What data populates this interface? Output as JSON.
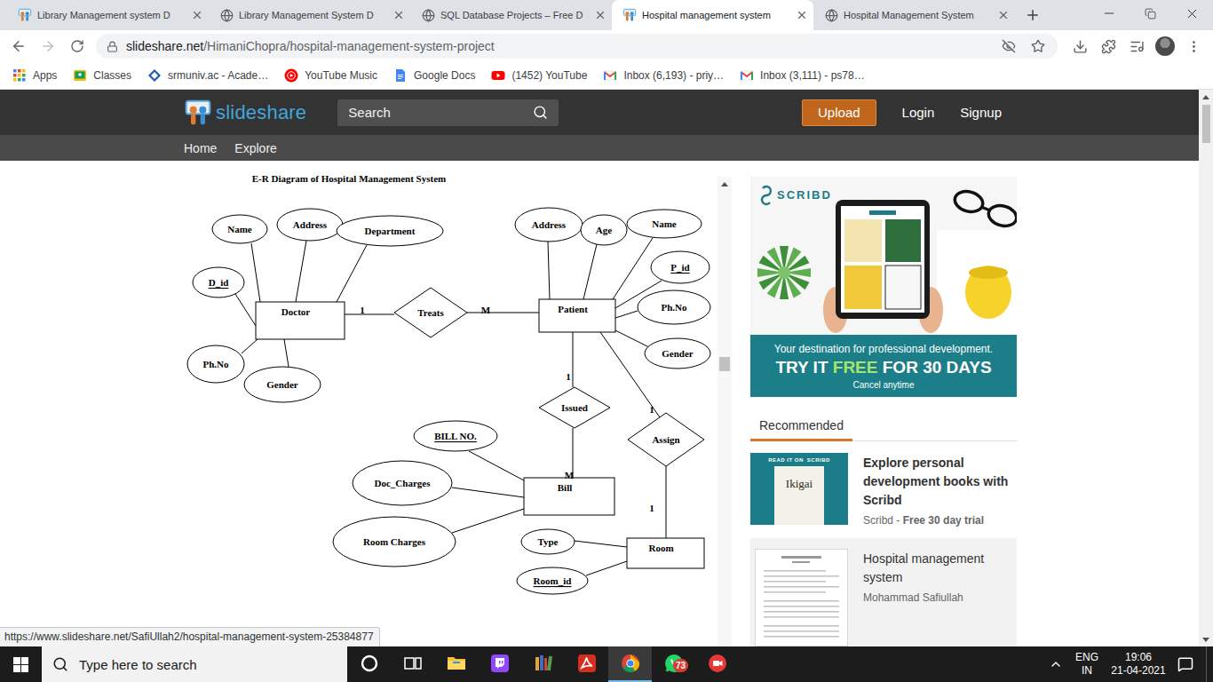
{
  "browser": {
    "tabs": [
      {
        "title": "Library Management system D",
        "selected": false,
        "kind": "slideshare"
      },
      {
        "title": "Library Management System D",
        "selected": false,
        "kind": "globe"
      },
      {
        "title": "SQL Database Projects – Free D",
        "selected": false,
        "kind": "globe"
      },
      {
        "title": "Hospital management system",
        "selected": true,
        "kind": "slideshare"
      },
      {
        "title": "Hospital Management System",
        "selected": false,
        "kind": "globe"
      }
    ],
    "address": {
      "host": "slideshare.net",
      "path": "/HimaniChopra/hospital-management-system-project"
    },
    "bookmarks": [
      {
        "label": "Apps",
        "kind": "apps"
      },
      {
        "label": "Classes",
        "kind": "classes"
      },
      {
        "label": "srmuniv.ac - Acade…",
        "kind": "srm"
      },
      {
        "label": "YouTube Music",
        "kind": "ytmusic"
      },
      {
        "label": "Google Docs",
        "kind": "docs"
      },
      {
        "label": "(1452) YouTube",
        "kind": "youtube"
      },
      {
        "label": "Inbox (6,193) - priy…",
        "kind": "gmail"
      },
      {
        "label": "Inbox (3,111) - ps78…",
        "kind": "gmail"
      }
    ]
  },
  "site": {
    "logo": "slideshare",
    "search": "Search",
    "upload": "Upload",
    "login": "Login",
    "signup": "Signup",
    "nav": [
      "Home",
      "Explore"
    ]
  },
  "diagram": {
    "title": "E-R Diagram of Hospital Management System",
    "nodes": [
      {
        "label": "Doctor",
        "kind": "entity",
        "key": false
      },
      {
        "label": "Patient",
        "kind": "entity",
        "key": false
      },
      {
        "label": "Bill",
        "kind": "entity",
        "key": false
      },
      {
        "label": "Room",
        "kind": "entity",
        "key": false
      },
      {
        "label": "Treats",
        "kind": "relationship",
        "key": false
      },
      {
        "label": "Issued",
        "kind": "relationship",
        "key": false
      },
      {
        "label": "Assign",
        "kind": "relationship",
        "key": false
      },
      {
        "label": "Name",
        "kind": "attribute",
        "key": false
      },
      {
        "label": "Address",
        "kind": "attribute",
        "key": false
      },
      {
        "label": "Department",
        "kind": "attribute",
        "key": false
      },
      {
        "label": "D_id",
        "kind": "attribute",
        "key": true
      },
      {
        "label": "Ph.No",
        "kind": "attribute",
        "key": false
      },
      {
        "label": "Gender",
        "kind": "attribute",
        "key": false
      },
      {
        "label": "Address",
        "kind": "attribute",
        "key": false
      },
      {
        "label": "Age",
        "kind": "attribute",
        "key": false
      },
      {
        "label": "Name",
        "kind": "attribute",
        "key": false
      },
      {
        "label": "P_id",
        "kind": "attribute",
        "key": true
      },
      {
        "label": "Ph.No",
        "kind": "attribute",
        "key": false
      },
      {
        "label": "Gender",
        "kind": "attribute",
        "key": false
      },
      {
        "label": "BILL NO.",
        "kind": "attribute",
        "key": true
      },
      {
        "label": "Doc_Charges",
        "kind": "attribute",
        "key": false
      },
      {
        "label": "Room Charges",
        "kind": "attribute",
        "key": false
      },
      {
        "label": "Type",
        "kind": "attribute",
        "key": false
      },
      {
        "label": "Room_id",
        "kind": "attribute",
        "key": true
      }
    ],
    "cardinalities": [
      "1",
      "M",
      "1",
      "M",
      "1",
      "1"
    ]
  },
  "ad": {
    "brand": "SCRIBD",
    "tagline": "Your destination for professional development.",
    "headline_start": "TRY IT ",
    "headline_accent": "FREE",
    "headline_end": " FOR 30 DAYS",
    "note": "Cancel anytime"
  },
  "recommended": {
    "heading": "Recommended",
    "items": [
      {
        "kind": "promo",
        "title": "Explore personal development books with Scribd",
        "meta": "Scribd - ",
        "meta_bold": "Free 30 day trial",
        "thumb_label": "READ IT ON",
        "thumb_brand": "SCRIBD",
        "thumb_title": "Ikigai"
      },
      {
        "kind": "document",
        "title": "Hospital management system",
        "meta": "Mohammad Safiullah"
      }
    ]
  },
  "status_url": "https://www.slideshare.net/SafiUllah2/hospital-management-system-25384877",
  "taskbar": {
    "search": "Type here to search",
    "apps": [
      {
        "kind": "cortana",
        "selected": false
      },
      {
        "kind": "taskview",
        "selected": false
      },
      {
        "kind": "explorer",
        "selected": false
      },
      {
        "kind": "twitch",
        "selected": false
      },
      {
        "kind": "library",
        "selected": false
      },
      {
        "kind": "acrobat",
        "selected": false
      },
      {
        "kind": "chrome",
        "selected": true
      },
      {
        "kind": "whatsapp",
        "selected": false,
        "badge": "73"
      },
      {
        "kind": "recorder",
        "selected": false
      }
    ],
    "language": "ENG",
    "region": "IN",
    "time": "19:06",
    "date": "21-04-2021"
  }
}
